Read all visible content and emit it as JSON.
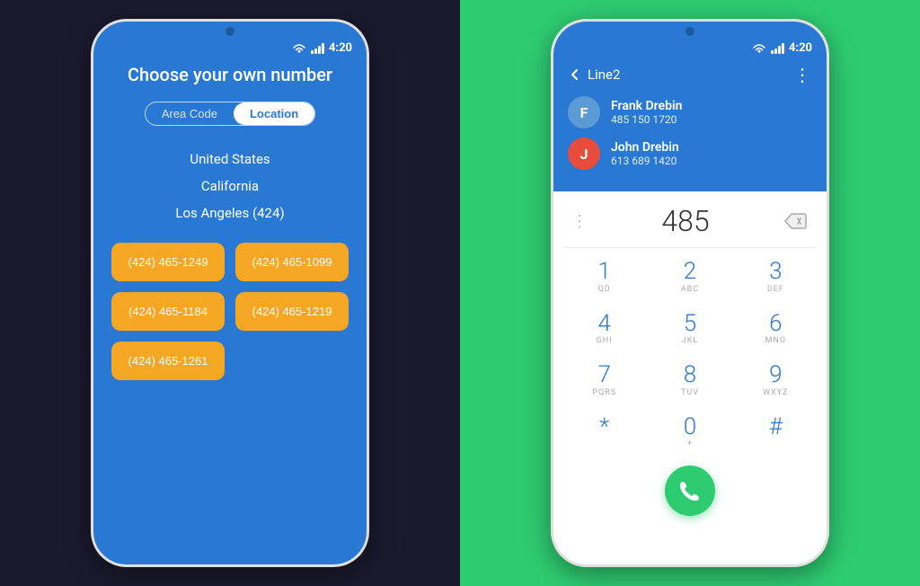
{
  "left_bg": "#1a1a2e",
  "right_bg": "#2ecc71",
  "left_phone": {
    "status": {
      "time": "4:20",
      "notch": true
    },
    "title": "Choose your own number",
    "toggle": {
      "area_code": "Area Code",
      "location": "Location",
      "active": "location"
    },
    "location_items": [
      "United States",
      "California",
      "Los Angeles (424)"
    ],
    "numbers": [
      "(424) 465-1249",
      "(424) 465-1099",
      "(424) 465-1184",
      "(424) 465-1219",
      "(424) 465-1261"
    ]
  },
  "right_phone": {
    "status": {
      "time": "4:20"
    },
    "header": {
      "back_label": "Line2",
      "more_icon": "⋮"
    },
    "contacts": [
      {
        "initial": "F",
        "name": "Frank Drebin",
        "number": "485 150 1720",
        "avatar_color": "#5b9bd5"
      },
      {
        "initial": "J",
        "name": "John Drebin",
        "number": "613 689 1420",
        "avatar_color": "#e74c3c"
      }
    ],
    "dial_display": "485",
    "dial_keys": [
      {
        "number": "1",
        "letters": "QD"
      },
      {
        "number": "2",
        "letters": "ABC"
      },
      {
        "number": "3",
        "letters": "DEF"
      },
      {
        "number": "4",
        "letters": "GHI"
      },
      {
        "number": "5",
        "letters": "JKL"
      },
      {
        "number": "6",
        "letters": "MNO"
      },
      {
        "number": "7",
        "letters": "PQRS"
      },
      {
        "number": "8",
        "letters": "TUV"
      },
      {
        "number": "9",
        "letters": "WXYZ"
      },
      {
        "number": "*",
        "letters": ""
      },
      {
        "number": "0",
        "letters": "+"
      },
      {
        "number": "#",
        "letters": ""
      }
    ]
  },
  "colors": {
    "orange": "#f5a623",
    "blue": "#2979d4",
    "green": "#2ecc71",
    "red": "#e74c3c"
  }
}
